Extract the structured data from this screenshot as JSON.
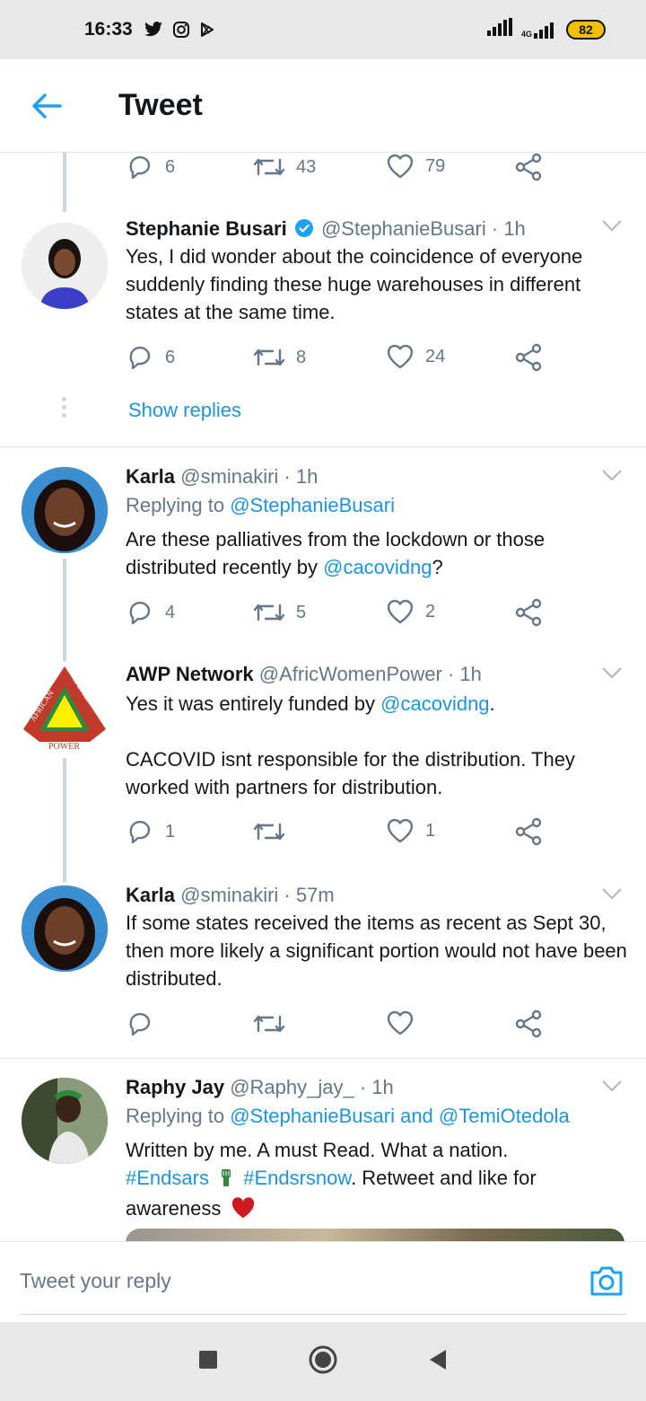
{
  "status_bar": {
    "time": "16:33",
    "network": "4G",
    "battery": "82"
  },
  "header": {
    "title": "Tweet"
  },
  "top_actions": {
    "replies": "6",
    "retweets": "43",
    "likes": "79"
  },
  "tweets": [
    {
      "name": "Stephanie Busari",
      "handle": "@StephanieBusari",
      "time": "· 1h",
      "verified": true,
      "text": "Yes, I did wonder about the coincidence of everyone suddenly finding these huge warehouses in different states at the same time.",
      "replies": "6",
      "retweets": "8",
      "likes": "24"
    },
    {
      "name": "Karla",
      "handle": "@sminakiri",
      "time": "· 1h",
      "replying_prefix": "Replying to ",
      "replying_to": "@StephanieBusari",
      "text_before": "Are these palliatives from the lockdown or those distributed recently by ",
      "mention": "@cacovidng",
      "text_after": "?",
      "replies": "4",
      "retweets": "5",
      "likes": "2"
    },
    {
      "name": "AWP Network",
      "handle": "@AfricWomenPower",
      "time": "· 1h",
      "avatar_text": {
        "left": "AFRICAN",
        "right": "WOMEN",
        "bottom": "POWER"
      },
      "text_before": "Yes it was entirely funded by ",
      "mention": "@cacovidng",
      "text_after": ".",
      "text2": "CACOVID isnt responsible for the distribution. They worked with partners for distribution.",
      "replies": "1",
      "retweets": "",
      "likes": "1"
    },
    {
      "name": "Karla",
      "handle": "@sminakiri",
      "time": "· 57m",
      "text": "If some states received the items as recent as Sept 30, then more likely a significant portion would not have been distributed.",
      "replies": "",
      "retweets": "",
      "likes": ""
    },
    {
      "name": "Raphy Jay",
      "handle": "@Raphy_jay_",
      "time": "· 1h",
      "replying_prefix": "Replying to ",
      "replying_to": "@StephanieBusari and @TemiOtedola",
      "text_line1": "Written by me. A must Read. What a nation.",
      "hashtag1": "#Endsars",
      "hashtag2": "#Endsrsnow",
      "text_after": ". Retweet and like for",
      "text_line3": "awareness"
    }
  ],
  "show_replies": "Show replies",
  "reply_bar": {
    "placeholder": "Tweet your reply"
  },
  "colors": {
    "link": "#1b95e0",
    "secondary": "#657786",
    "divider": "#e1e8ed",
    "verified": "#1da1f2"
  }
}
